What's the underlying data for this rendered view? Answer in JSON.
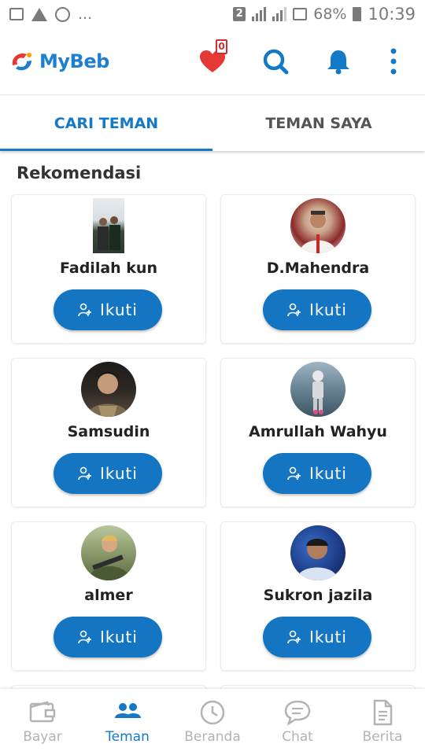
{
  "status_bar": {
    "left_icons": [
      "image-icon",
      "warning-icon",
      "whatsapp-icon",
      "more-dots"
    ],
    "more": "...",
    "sim": "2",
    "battery_percent": "68%",
    "time": "10:39"
  },
  "app": {
    "name": "MyBeb",
    "brand_color": "#1e7fd0",
    "favorites_count": "0"
  },
  "tabs": [
    {
      "label": "CARI TEMAN",
      "active": true
    },
    {
      "label": "TEMAN SAYA",
      "active": false
    }
  ],
  "section": {
    "title": "Rekomendasi"
  },
  "cards": [
    {
      "name": "Fadilah kun",
      "follow_label": "Ikuti"
    },
    {
      "name": "D.Mahendra",
      "follow_label": "Ikuti"
    },
    {
      "name": "Samsudin",
      "follow_label": "Ikuti"
    },
    {
      "name": "Amrullah Wahyu",
      "follow_label": "Ikuti"
    },
    {
      "name": "almer",
      "follow_label": "Ikuti"
    },
    {
      "name": "Sukron jazila",
      "follow_label": "Ikuti"
    }
  ],
  "bottom_nav": [
    {
      "label": "Bayar",
      "icon": "wallet-icon",
      "active": false
    },
    {
      "label": "Teman",
      "icon": "people-icon",
      "active": true
    },
    {
      "label": "Beranda",
      "icon": "clock-icon",
      "active": false
    },
    {
      "label": "Chat",
      "icon": "chat-bubble-icon",
      "active": false
    },
    {
      "label": "Berita",
      "icon": "document-icon",
      "active": false
    }
  ],
  "colors": {
    "accent": "#1479c6",
    "button": "#1475c2",
    "inactive": "#b3b3b3",
    "heart": "#e53935"
  }
}
